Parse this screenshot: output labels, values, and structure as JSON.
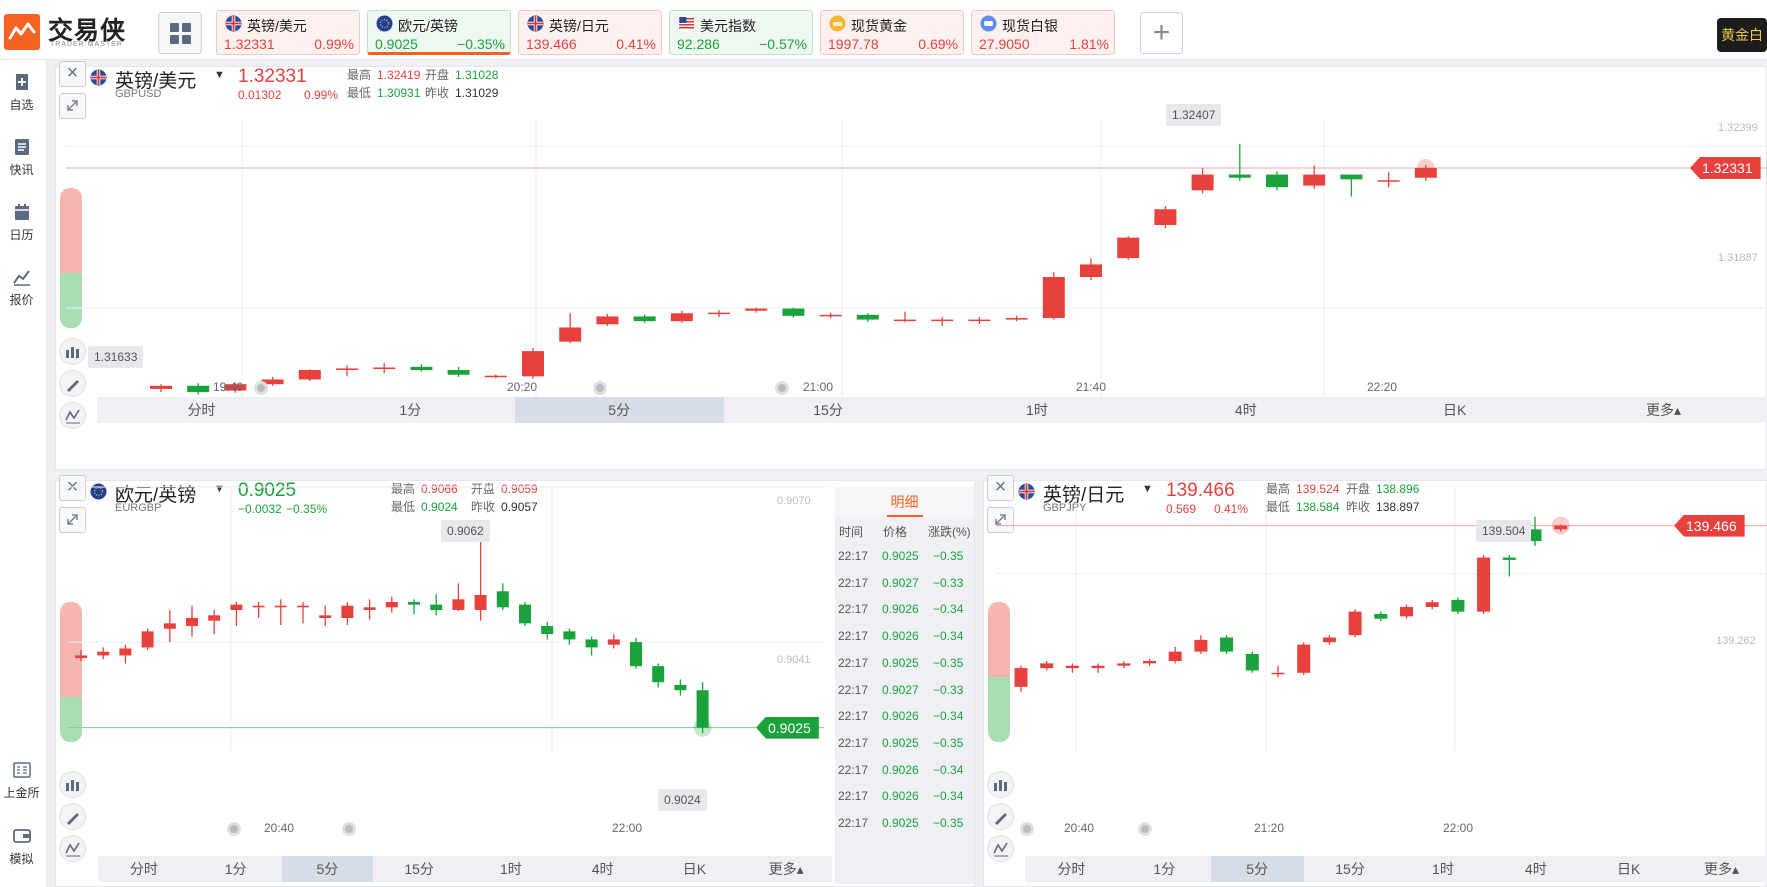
{
  "app": {
    "logo_text": "交易侠",
    "logo_sub": "TRADER MASTER",
    "right_tag": "黄金白"
  },
  "tabs": [
    {
      "name": "英镑/美元",
      "price": "1.32331",
      "change": "0.99%",
      "trend": "up",
      "flag": "uk-flag-icon"
    },
    {
      "name": "欧元/英镑",
      "price": "0.9025",
      "change": "−0.35%",
      "trend": "down",
      "flag": "eu-flag-icon",
      "active": true
    },
    {
      "name": "英镑/日元",
      "price": "139.466",
      "change": "0.41%",
      "trend": "up",
      "flag": "uk-flag-icon"
    },
    {
      "name": "美元指数",
      "price": "92.286",
      "change": "−0.57%",
      "trend": "down",
      "flag": "us-flag-icon"
    },
    {
      "name": "现货黄金",
      "price": "1997.78",
      "change": "0.69%",
      "trend": "up",
      "flag": "gold-icon"
    },
    {
      "name": "现货白银",
      "price": "27.9050",
      "change": "1.81%",
      "trend": "up",
      "flag": "silver-icon"
    }
  ],
  "sidebar": [
    {
      "label": "自选",
      "icon": "bookmark-add-icon"
    },
    {
      "label": "快讯",
      "icon": "news-icon"
    },
    {
      "label": "日历",
      "icon": "calendar-icon"
    },
    {
      "label": "报价",
      "icon": "line-chart-icon"
    },
    {
      "label": "上金所",
      "icon": "exchange-icon"
    },
    {
      "label": "模拟",
      "icon": "wallet-icon"
    }
  ],
  "stat_labels": {
    "high": "最高",
    "open": "开盘",
    "low": "最低",
    "prev": "昨收"
  },
  "timeframes_top": [
    "分时",
    "1分",
    "5分",
    "15分",
    "1时",
    "4时",
    "日K",
    "更多▴"
  ],
  "panels": {
    "gbpusd": {
      "title": "英镑/美元",
      "code": "GBPUSD",
      "price": "1.32331",
      "change": "0.01302",
      "pct": "0.99%",
      "high": "1.32419",
      "open": "1.31028",
      "low": "1.30931",
      "prev": "1.31029",
      "tag": "1.32331",
      "max_bubble": "1.32407",
      "min_bubble": "1.31633",
      "ghost_labels": [
        "1.32399",
        "1.31887"
      ],
      "times": [
        "19:40",
        "20:20",
        "21:00",
        "21:40",
        "22:20"
      ],
      "selected_tf": 2,
      "candles": [
        [
          1.3163,
          1.3164,
          1.3162,
          1.31645,
          "u"
        ],
        [
          1.3162,
          1.3164,
          1.31612,
          1.31648,
          "d"
        ],
        [
          1.31625,
          1.31645,
          1.31618,
          1.3165,
          "u"
        ],
        [
          1.31645,
          1.3166,
          1.3164,
          1.31668,
          "u"
        ],
        [
          1.3166,
          1.3169,
          1.31655,
          1.31692,
          "u"
        ],
        [
          1.3169,
          1.31695,
          1.3167,
          1.31705,
          "u"
        ],
        [
          1.31695,
          1.31698,
          1.3168,
          1.31712,
          "u"
        ],
        [
          1.317,
          1.3169,
          1.31685,
          1.31708,
          "d"
        ],
        [
          1.3169,
          1.31675,
          1.31668,
          1.317,
          "d"
        ],
        [
          1.3167,
          1.31672,
          1.31664,
          1.31676,
          "u"
        ],
        [
          1.3167,
          1.3175,
          1.31662,
          1.3176,
          "u"
        ],
        [
          1.3178,
          1.31825,
          1.31775,
          1.3187,
          "u"
        ],
        [
          1.31835,
          1.3186,
          1.3183,
          1.31868,
          "u"
        ],
        [
          1.3186,
          1.31845,
          1.3184,
          1.31866,
          "d"
        ],
        [
          1.31845,
          1.3187,
          1.3184,
          1.31878,
          "u"
        ],
        [
          1.3187,
          1.31872,
          1.31858,
          1.3188,
          "u"
        ],
        [
          1.31878,
          1.31885,
          1.31872,
          1.31888,
          "u"
        ],
        [
          1.31885,
          1.31862,
          1.31856,
          1.31888,
          "d"
        ],
        [
          1.31865,
          1.31865,
          1.31855,
          1.31872,
          "u"
        ],
        [
          1.31865,
          1.3185,
          1.31843,
          1.3187,
          "d"
        ],
        [
          1.3185,
          1.3185,
          1.31842,
          1.31875,
          "u"
        ],
        [
          1.3185,
          1.3185,
          1.3183,
          1.31858,
          "u"
        ],
        [
          1.3185,
          1.3185,
          1.31836,
          1.31858,
          "u"
        ],
        [
          1.3185,
          1.31855,
          1.31845,
          1.31862,
          "u"
        ],
        [
          1.31855,
          1.31985,
          1.3185,
          1.32,
          "u"
        ],
        [
          1.31985,
          1.32025,
          1.31975,
          1.32045,
          "u"
        ],
        [
          1.32045,
          1.3211,
          1.3204,
          1.32115,
          "u"
        ],
        [
          1.3215,
          1.322,
          1.3214,
          1.3221,
          "u"
        ],
        [
          1.3226,
          1.3231,
          1.3225,
          1.3233,
          "u"
        ],
        [
          1.3231,
          1.323,
          1.3229,
          1.32407,
          "d"
        ],
        [
          1.3231,
          1.3227,
          1.3226,
          1.3232,
          "d"
        ],
        [
          1.32275,
          1.3231,
          1.32265,
          1.3234,
          "u"
        ],
        [
          1.3231,
          1.32295,
          1.3224,
          1.3231,
          "d"
        ],
        [
          1.3229,
          1.32292,
          1.3227,
          1.32318,
          "u"
        ],
        [
          1.323,
          1.32331,
          1.3229,
          1.3234,
          "u"
        ]
      ]
    },
    "eurgbp": {
      "title": "欧元/英镑",
      "code": "EURGBP",
      "price": "0.9025",
      "change": "−0.0032",
      "pct": "−0.35%",
      "high": "0.9066",
      "open": "0.9059",
      "low": "0.9024",
      "prev": "0.9057",
      "tag": "0.9025",
      "max_bubble": "0.9062",
      "min_bubble": "0.9024",
      "ghost_labels": [
        "0.9070",
        "0.9041"
      ],
      "times": [
        "20:40",
        "22:00"
      ],
      "selected_tf": 2,
      "candles": [
        [
          0.9038,
          0.90385,
          0.90375,
          0.90395,
          "u"
        ],
        [
          0.90385,
          0.90392,
          0.90378,
          0.904,
          "u"
        ],
        [
          0.90385,
          0.90398,
          0.9037,
          0.90405,
          "u"
        ],
        [
          0.904,
          0.9043,
          0.90395,
          0.90435,
          "u"
        ],
        [
          0.90435,
          0.90445,
          0.9041,
          0.9047,
          "u"
        ],
        [
          0.9044,
          0.90455,
          0.9042,
          0.90478,
          "u"
        ],
        [
          0.9045,
          0.9046,
          0.90425,
          0.9047,
          "u"
        ],
        [
          0.9047,
          0.9048,
          0.9044,
          0.90485,
          "u"
        ],
        [
          0.90475,
          0.90478,
          0.90455,
          0.90485,
          "u"
        ],
        [
          0.90475,
          0.90478,
          0.90442,
          0.9049,
          "u"
        ],
        [
          0.90475,
          0.90478,
          0.90445,
          0.90485,
          "u"
        ],
        [
          0.9046,
          0.90455,
          0.9044,
          0.90478,
          "u"
        ],
        [
          0.90455,
          0.90478,
          0.90442,
          0.90485,
          "u"
        ],
        [
          0.9047,
          0.90475,
          0.90452,
          0.9049,
          "u"
        ],
        [
          0.90475,
          0.90485,
          0.90465,
          0.90495,
          "u"
        ],
        [
          0.90485,
          0.9048,
          0.90462,
          0.9049,
          "d"
        ],
        [
          0.9048,
          0.9047,
          0.9046,
          0.905,
          "d"
        ],
        [
          0.9047,
          0.9049,
          0.90468,
          0.9052,
          "u"
        ],
        [
          0.9047,
          0.90498,
          0.9045,
          0.9062,
          "u"
        ],
        [
          0.90505,
          0.90475,
          0.9047,
          0.9052,
          "d"
        ],
        [
          0.9048,
          0.90445,
          0.9044,
          0.90485,
          "d"
        ],
        [
          0.9044,
          0.90425,
          0.90415,
          0.90448,
          "d"
        ],
        [
          0.9043,
          0.90415,
          0.90405,
          0.90435,
          "d"
        ],
        [
          0.90415,
          0.904,
          0.90385,
          0.9042,
          "d"
        ],
        [
          0.90405,
          0.90415,
          0.90398,
          0.90425,
          "u"
        ],
        [
          0.9041,
          0.90365,
          0.9036,
          0.90418,
          "d"
        ],
        [
          0.90365,
          0.90335,
          0.90325,
          0.9037,
          "d"
        ],
        [
          0.9033,
          0.9032,
          0.9031,
          0.9034,
          "d"
        ],
        [
          0.9032,
          0.9025,
          0.9024,
          0.90335,
          "d"
        ]
      ]
    },
    "gbpjpy": {
      "title": "英镑/日元",
      "code": "GBPJPY",
      "price": "139.466",
      "change": "0.569",
      "pct": "0.41%",
      "high": "139.524",
      "open": "138.896",
      "low": "138.584",
      "prev": "138.897",
      "tag": "139.466",
      "max_bubble": "139.504",
      "ghost_labels": [
        "139.262"
      ],
      "times": [
        "20:40",
        "21:20",
        "22:00"
      ],
      "selected_tf": 2,
      "candles": [
        [
          138.78,
          138.86,
          138.76,
          138.87,
          "u"
        ],
        [
          138.86,
          138.88,
          138.85,
          138.89,
          "u"
        ],
        [
          138.87,
          138.86,
          138.84,
          138.88,
          "u"
        ],
        [
          138.86,
          138.87,
          138.84,
          138.88,
          "u"
        ],
        [
          138.87,
          138.88,
          138.86,
          138.89,
          "u"
        ],
        [
          138.88,
          138.89,
          138.87,
          138.9,
          "u"
        ],
        [
          138.89,
          138.93,
          138.88,
          138.95,
          "u"
        ],
        [
          138.93,
          138.98,
          138.92,
          139.0,
          "u"
        ],
        [
          138.99,
          138.93,
          138.92,
          139.0,
          "d"
        ],
        [
          138.92,
          138.85,
          138.84,
          138.93,
          "d"
        ],
        [
          138.84,
          138.84,
          138.82,
          138.87,
          "u"
        ],
        [
          138.84,
          138.96,
          138.83,
          138.97,
          "u"
        ],
        [
          138.97,
          138.99,
          138.96,
          139.0,
          "u"
        ],
        [
          139.0,
          139.1,
          138.99,
          139.11,
          "u"
        ],
        [
          139.09,
          139.07,
          139.06,
          139.1,
          "d"
        ],
        [
          139.08,
          139.12,
          139.07,
          139.13,
          "u"
        ],
        [
          139.12,
          139.14,
          139.11,
          139.15,
          "u"
        ],
        [
          139.15,
          139.1,
          139.09,
          139.16,
          "d"
        ],
        [
          139.1,
          139.33,
          139.09,
          139.34,
          "u"
        ],
        [
          139.33,
          139.32,
          139.25,
          139.34,
          "d"
        ],
        [
          139.45,
          139.4,
          139.38,
          139.504,
          "d"
        ],
        [
          139.45,
          139.466,
          139.44,
          139.47,
          "u"
        ]
      ]
    }
  },
  "detail": {
    "header": "明细",
    "columns": [
      "时间",
      "价格",
      "涨跌(%)"
    ],
    "rows": [
      [
        "22:17",
        "0.9025",
        "−0.35"
      ],
      [
        "22:17",
        "0.9027",
        "−0.33"
      ],
      [
        "22:17",
        "0.9026",
        "−0.34"
      ],
      [
        "22:17",
        "0.9026",
        "−0.34"
      ],
      [
        "22:17",
        "0.9025",
        "−0.35"
      ],
      [
        "22:17",
        "0.9027",
        "−0.33"
      ],
      [
        "22:17",
        "0.9026",
        "−0.34"
      ],
      [
        "22:17",
        "0.9025",
        "−0.35"
      ],
      [
        "22:17",
        "0.9026",
        "−0.34"
      ],
      [
        "22:17",
        "0.9026",
        "−0.34"
      ],
      [
        "22:17",
        "0.9025",
        "−0.35"
      ]
    ]
  },
  "colors": {
    "up": "#e8413d",
    "down": "#1aa33a",
    "accent": "#f5611e"
  }
}
